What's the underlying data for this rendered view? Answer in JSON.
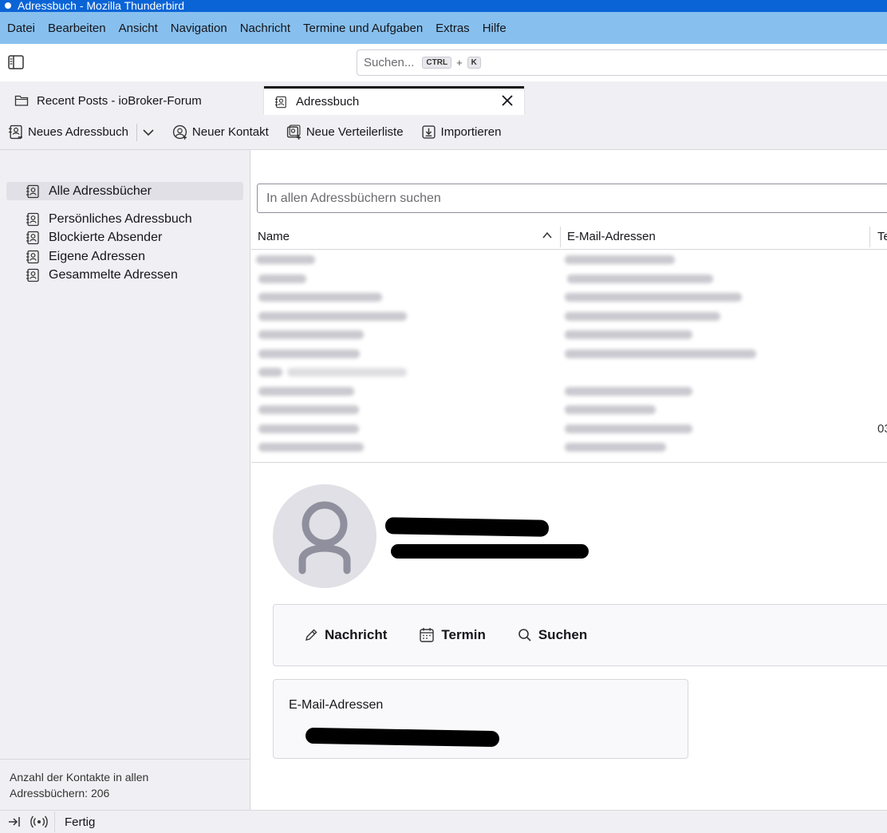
{
  "window": {
    "title": "Adressbuch - Mozilla Thunderbird"
  },
  "menu": {
    "items": [
      "Datei",
      "Bearbeiten",
      "Ansicht",
      "Navigation",
      "Nachricht",
      "Termine und Aufgaben",
      "Extras",
      "Hilfe"
    ]
  },
  "search": {
    "placeholder": "Suchen...",
    "shortcut_key1": "CTRL",
    "shortcut_plus": "+",
    "shortcut_key2": "K"
  },
  "tabs": [
    {
      "label": "Recent Posts - ioBroker-Forum",
      "icon": "folder-icon",
      "active": false
    },
    {
      "label": "Adressbuch",
      "icon": "address-book-icon",
      "active": true
    }
  ],
  "toolbar": {
    "new_addressbook": "Neues Adressbuch",
    "new_contact": "Neuer Kontakt",
    "new_list": "Neue Verteilerliste",
    "import": "Importieren"
  },
  "sidebar": {
    "all_books": "Alle Adressbücher",
    "books": [
      "Persönliches Adressbuch",
      "Blockierte Absender",
      "Eigene Adressen",
      "Gesammelte Adressen"
    ],
    "footer_line1": "Anzahl der Kontakte in allen",
    "footer_line2": "Adressbüchern: 206"
  },
  "list": {
    "search_placeholder": "In allen Adressbüchern suchen",
    "columns": {
      "name": "Name",
      "email": "E-Mail-Adressen",
      "tel": "Te"
    },
    "partial_tel": "03"
  },
  "contact": {
    "actions": {
      "message": "Nachricht",
      "event": "Termin",
      "search": "Suchen"
    },
    "email_header": "E-Mail-Adressen"
  },
  "status": {
    "text": "Fertig"
  },
  "colors": {
    "titlebar": "#0a64d6",
    "menubar": "#87c0ee",
    "sidebar": "#f0f0f4"
  }
}
